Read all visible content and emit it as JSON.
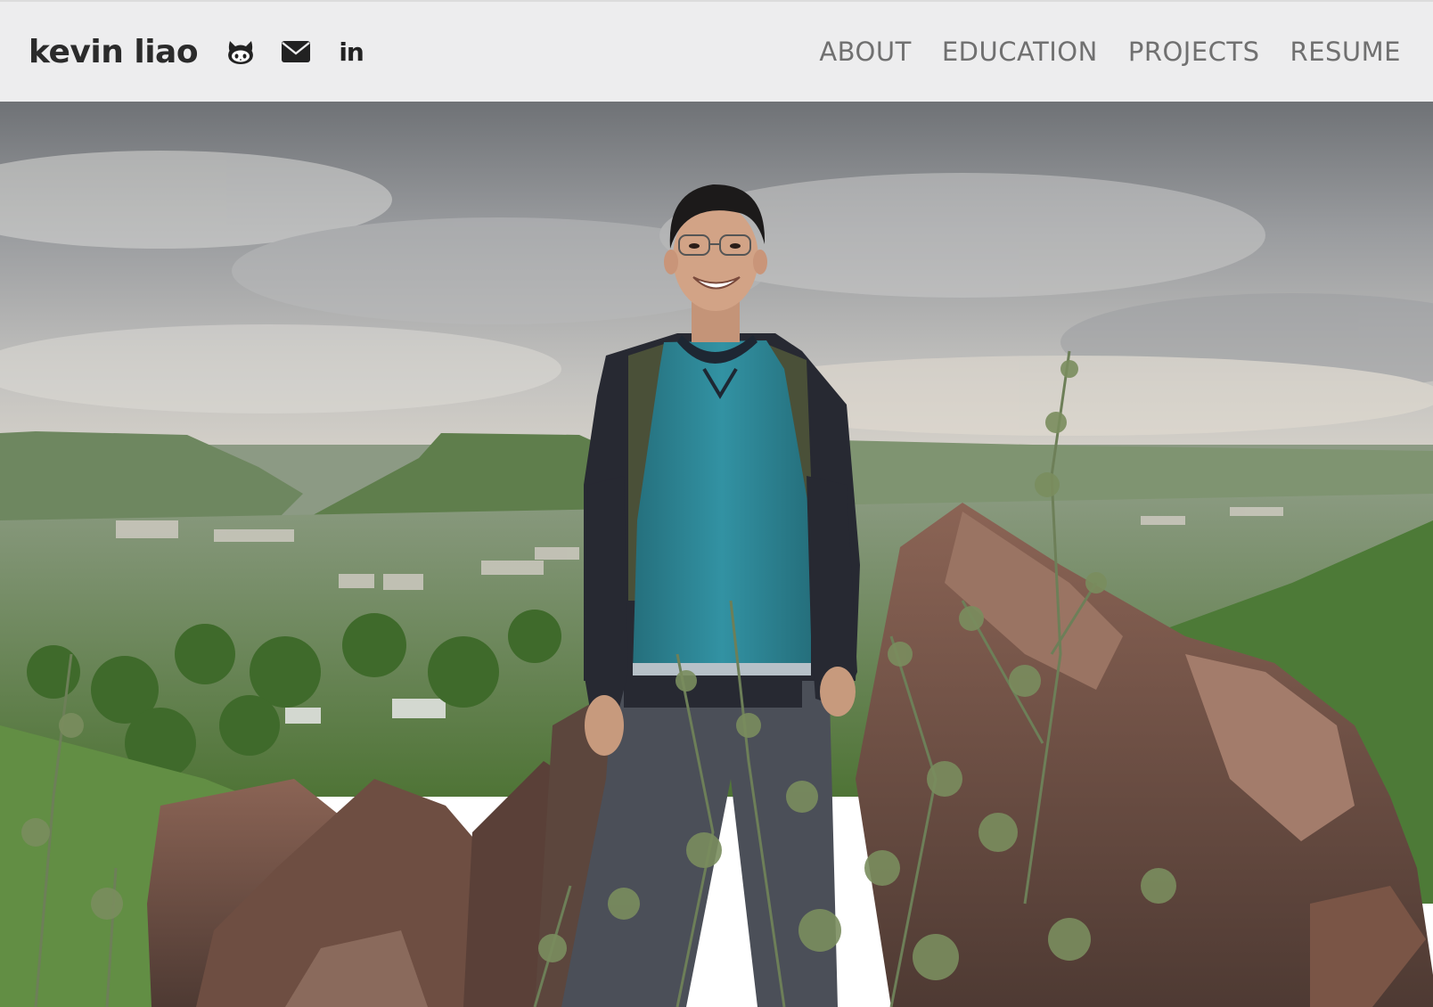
{
  "navbar": {
    "brand": "kevin liao",
    "social": [
      {
        "name": "github",
        "icon": "github-icon"
      },
      {
        "name": "email",
        "icon": "envelope-icon"
      },
      {
        "name": "linkedin",
        "icon": "linkedin-icon",
        "text": "in"
      }
    ],
    "links": [
      {
        "label": "ABOUT"
      },
      {
        "label": "EDUCATION"
      },
      {
        "label": "PROJECTS"
      },
      {
        "label": "RESUME"
      }
    ]
  },
  "hero": {
    "photo": "photo-of-person-standing-on-rocks-overlooking-town-and-mesas",
    "colors": {
      "sky": "#a6a8aa",
      "hills": "#6f8a5e",
      "shirt": "#2f8595",
      "jacket": "#2a2c33",
      "rocks": "#7d5648"
    }
  }
}
